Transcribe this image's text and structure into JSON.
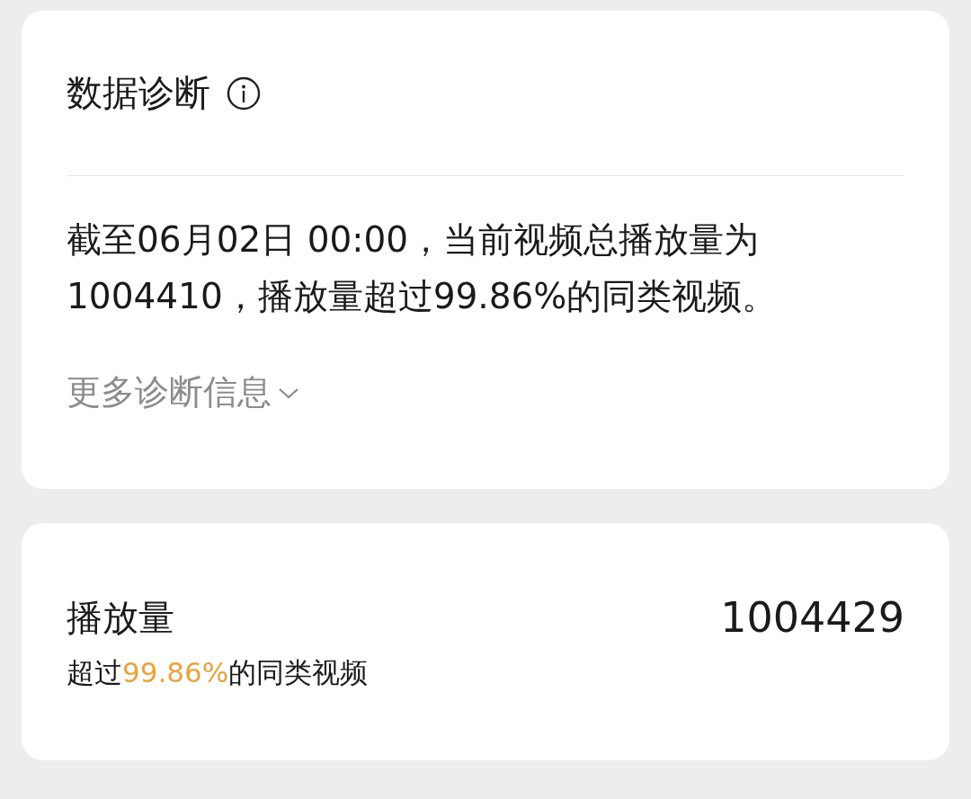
{
  "diagnosis": {
    "title": "数据诊断",
    "text_lines": [
      "截至06月02日 00:00，当前视频总播放量为",
      "1004410，播放量超过99.86%的同类视频。"
    ],
    "more_link": {
      "label": "更多诊断信息",
      "expanded": false
    }
  },
  "play_count": {
    "label": "播放量",
    "value": "1004429",
    "subtitle": {
      "before": "超过",
      "highlight": "99.86%",
      "after": "的同类视频"
    }
  }
}
